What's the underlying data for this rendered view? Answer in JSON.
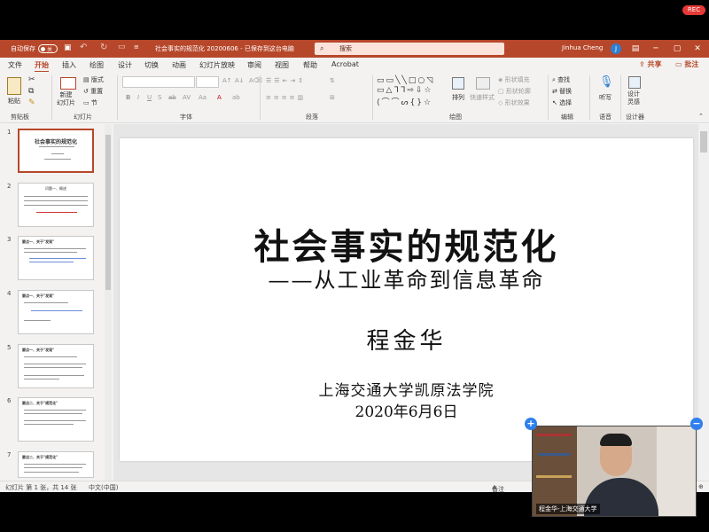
{
  "rec_badge": "REC",
  "titlebar": {
    "autosave_label": "自动保存",
    "autosave_state": "关",
    "doc_title": "社会事实的规范化 20200606 - 已保存到这台电脑",
    "search_placeholder": "搜索",
    "user_name": "Jinhua Cheng",
    "user_initial": "J"
  },
  "menu": {
    "items": [
      "文件",
      "开始",
      "插入",
      "绘图",
      "设计",
      "切换",
      "动画",
      "幻灯片放映",
      "审阅",
      "视图",
      "帮助",
      "Acrobat"
    ],
    "active": "开始",
    "share": "共享",
    "comment": "批注"
  },
  "ribbon": {
    "clipboard": {
      "paste": "粘贴",
      "group": "剪贴板"
    },
    "slides": {
      "new_slide": "新建\n幻灯片",
      "layout": "版式",
      "reset": "重置",
      "section": "节",
      "group": "幻灯片"
    },
    "font": {
      "group": "字体"
    },
    "paragraph": {
      "group": "段落"
    },
    "drawing": {
      "arrange": "排列",
      "quick_styles": "快速样式",
      "fill": "形状填充",
      "outline": "形状轮廓",
      "effects": "形状效果",
      "group": "绘图"
    },
    "editing": {
      "find": "查找",
      "replace": "替换",
      "select": "选择",
      "group": "编辑"
    },
    "voice": {
      "dictate": "听写",
      "group": "语音"
    },
    "designer": {
      "ideas": "设计\n灵感",
      "group": "设计器"
    }
  },
  "thumbnails": [
    {
      "num": "1",
      "title": "社会事实的规范化"
    },
    {
      "num": "2",
      "title": "问题一、概述"
    },
    {
      "num": "3",
      "title": "要点一、关于\"发现\""
    },
    {
      "num": "4",
      "title": "要点一、关于\"发现\""
    },
    {
      "num": "5",
      "title": "要点一、关于\"发现\""
    },
    {
      "num": "6",
      "title": "要点二、关于\"规范化\""
    },
    {
      "num": "7",
      "title": "要点二、关于\"规范化\""
    }
  ],
  "slide": {
    "title": "社会事实的规范化",
    "subtitle": "——从工业革命到信息革命",
    "author": "程金华",
    "institution": "上海交通大学凯原法学院",
    "date": "2020年6月6日"
  },
  "statusbar": {
    "slide_info": "幻灯片 第 1 张，共 14 张",
    "language": "中文(中国)",
    "notes": "备注"
  },
  "video": {
    "name": "程金华-上海交通大学"
  },
  "colors": {
    "accent": "#b7472a",
    "video_button": "#2f80ed"
  }
}
